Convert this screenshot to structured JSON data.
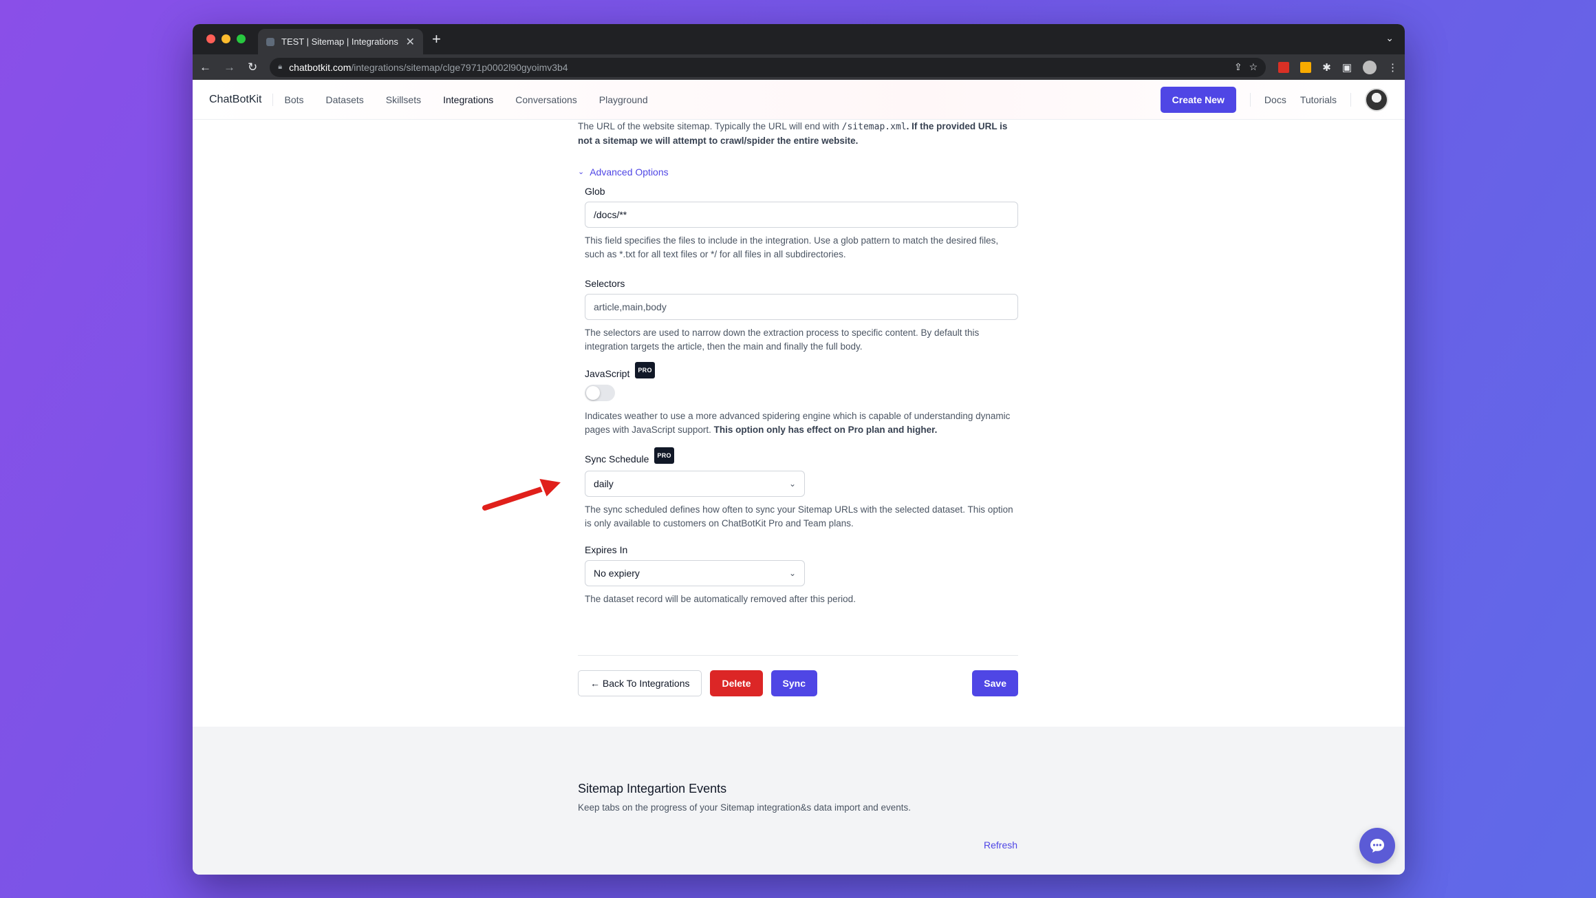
{
  "browser": {
    "tab_title": "TEST | Sitemap | Integrations |",
    "tab_close": "✕",
    "new_tab": "+",
    "tab_menu": "⌄",
    "url_host": "chatbotkit.com",
    "url_path": "/integrations/sitemap/clge7971p0002l90gyoimv3b4"
  },
  "nav": {
    "brand": "ChatBotKit",
    "links": [
      "Bots",
      "Datasets",
      "Skillsets",
      "Integrations",
      "Conversations",
      "Playground"
    ],
    "create_new": "Create New",
    "docs": "Docs",
    "tutorials": "Tutorials"
  },
  "form": {
    "url_help_prefix": "The URL of the website sitemap. Typically the URL will end with ",
    "url_help_code": "/sitemap.xml",
    "url_help_bold": ". If the provided URL is not a sitemap we will attempt to crawl/spider the entire website.",
    "advanced_label": "Advanced Options",
    "glob": {
      "label": "Glob",
      "value": "/docs/**",
      "help": "This field specifies the files to include in the integration. Use a glob pattern to match the desired files, such as *.txt for all text files or */ for all files in all subdirectories."
    },
    "selectors": {
      "label": "Selectors",
      "placeholder": "article,main,body",
      "help": "The selectors are used to narrow down the extraction process to specific content. By default this integration targets the article, then the main and finally the full body."
    },
    "javascript": {
      "label": "JavaScript",
      "badge": "PRO",
      "enabled": false,
      "help": "Indicates weather to use a more advanced spidering engine which is capable of understanding dynamic pages with JavaScript support. ",
      "help_bold": "This option only has effect on Pro plan and higher."
    },
    "sync_schedule": {
      "label": "Sync Schedule",
      "badge": "PRO",
      "value": "daily",
      "help": "The sync scheduled defines how often to sync your Sitemap URLs with the selected dataset. This option is only available to customers on ChatBotKit Pro and Team plans."
    },
    "expires_in": {
      "label": "Expires In",
      "value": "No expiery",
      "help": "The dataset record will be automatically removed after this period."
    }
  },
  "actions": {
    "back": "← Back To Integrations",
    "delete": "Delete",
    "sync": "Sync",
    "save": "Save"
  },
  "events": {
    "title": "Sitemap Integartion Events",
    "subtitle": "Keep tabs on the progress of your Sitemap integration&s data import and events.",
    "refresh": "Refresh"
  },
  "colors": {
    "accent": "#4f46e5",
    "danger": "#dc2626",
    "annotation_arrow": "#e0201b"
  }
}
